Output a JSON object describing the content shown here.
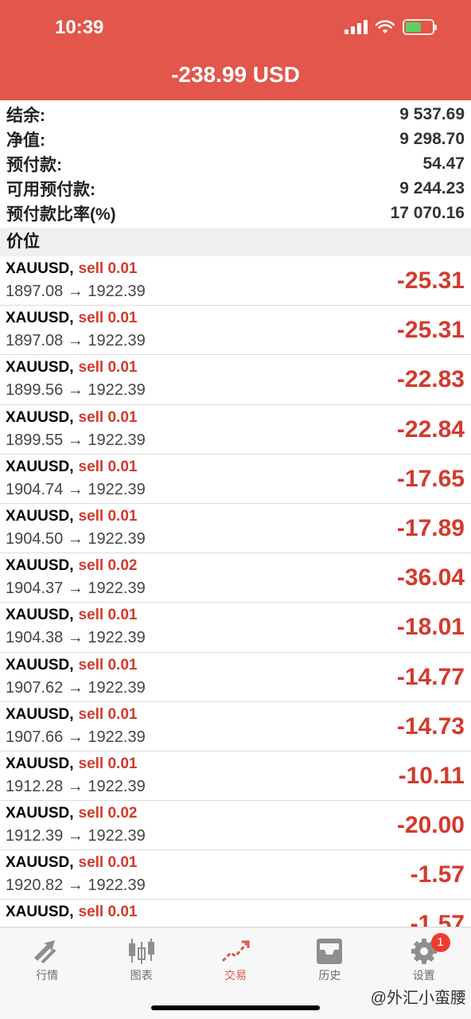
{
  "status_bar": {
    "time": "10:39"
  },
  "header": {
    "title": "-238.99 USD",
    "accent_color": "#e2564b"
  },
  "summary": [
    {
      "label": "结余:",
      "value": "9 537.69"
    },
    {
      "label": "净值:",
      "value": "9 298.70"
    },
    {
      "label": "预付款:",
      "value": "54.47"
    },
    {
      "label": "可用预付款:",
      "value": "9 244.23"
    },
    {
      "label": "预付款比率(%)",
      "value": "17 070.16"
    }
  ],
  "section": {
    "title": "价位"
  },
  "positions": [
    {
      "symbol": "XAUUSD,",
      "side": "sell 0.01",
      "prices": "1897.08 → 1922.39",
      "profit": "-25.31"
    },
    {
      "symbol": "XAUUSD,",
      "side": "sell 0.01",
      "prices": "1897.08 → 1922.39",
      "profit": "-25.31"
    },
    {
      "symbol": "XAUUSD,",
      "side": "sell 0.01",
      "prices": "1899.56 → 1922.39",
      "profit": "-22.83"
    },
    {
      "symbol": "XAUUSD,",
      "side": "sell 0.01",
      "prices": "1899.55 → 1922.39",
      "profit": "-22.84"
    },
    {
      "symbol": "XAUUSD,",
      "side": "sell 0.01",
      "prices": "1904.74 → 1922.39",
      "profit": "-17.65"
    },
    {
      "symbol": "XAUUSD,",
      "side": "sell 0.01",
      "prices": "1904.50 → 1922.39",
      "profit": "-17.89"
    },
    {
      "symbol": "XAUUSD,",
      "side": "sell 0.02",
      "prices": "1904.37 → 1922.39",
      "profit": "-36.04"
    },
    {
      "symbol": "XAUUSD,",
      "side": "sell 0.01",
      "prices": "1904.38 → 1922.39",
      "profit": "-18.01"
    },
    {
      "symbol": "XAUUSD,",
      "side": "sell 0.01",
      "prices": "1907.62 → 1922.39",
      "profit": "-14.77"
    },
    {
      "symbol": "XAUUSD,",
      "side": "sell 0.01",
      "prices": "1907.66 → 1922.39",
      "profit": "-14.73"
    },
    {
      "symbol": "XAUUSD,",
      "side": "sell 0.01",
      "prices": "1912.28 → 1922.39",
      "profit": "-10.11"
    },
    {
      "symbol": "XAUUSD,",
      "side": "sell 0.02",
      "prices": "1912.39 → 1922.39",
      "profit": "-20.00"
    },
    {
      "symbol": "XAUUSD,",
      "side": "sell 0.01",
      "prices": "1920.82 → 1922.39",
      "profit": "-1.57"
    },
    {
      "symbol": "XAUUSD,",
      "side": "sell 0.01",
      "prices": "",
      "profit": "-1.57"
    }
  ],
  "tabbar": {
    "tabs": [
      {
        "label": "行情",
        "icon": "quotes-arrows-icon"
      },
      {
        "label": "图表",
        "icon": "candlestick-chart-icon"
      },
      {
        "label": "交易",
        "icon": "trade-trend-icon",
        "active": true
      },
      {
        "label": "历史",
        "icon": "history-inbox-icon"
      },
      {
        "label": "设置",
        "icon": "settings-gear-icon",
        "badge": "1"
      }
    ]
  },
  "watermark": "@外汇小蛮腰"
}
